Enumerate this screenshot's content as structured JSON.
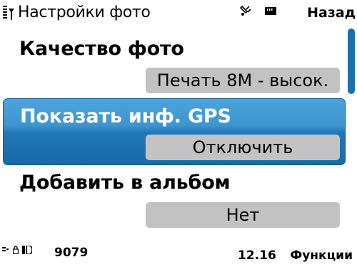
{
  "statusbar": {
    "title": "Настройки фото",
    "right_softkey": "Назад",
    "icons": [
      "signal-icon",
      "gps-status-icon",
      "memory-card-icon"
    ]
  },
  "settings": [
    {
      "label": "Качество фото",
      "value": "Печать 8M - высок.",
      "selected": false
    },
    {
      "label": "Показать инф. GPS",
      "value": "Отключить",
      "selected": true
    },
    {
      "label": "Добавить в альбом",
      "value": "Нет",
      "selected": false
    }
  ],
  "bottombar": {
    "remaining_photos": "9079",
    "time": "12.16",
    "left_softkey": "Функции",
    "icons": [
      "network-icon",
      "lock-icon",
      "battery-icon"
    ]
  },
  "colors": {
    "selection": "#2a81c0",
    "value_box": "#c2c2c2",
    "scroll_thumb": "#1d6fb0"
  }
}
